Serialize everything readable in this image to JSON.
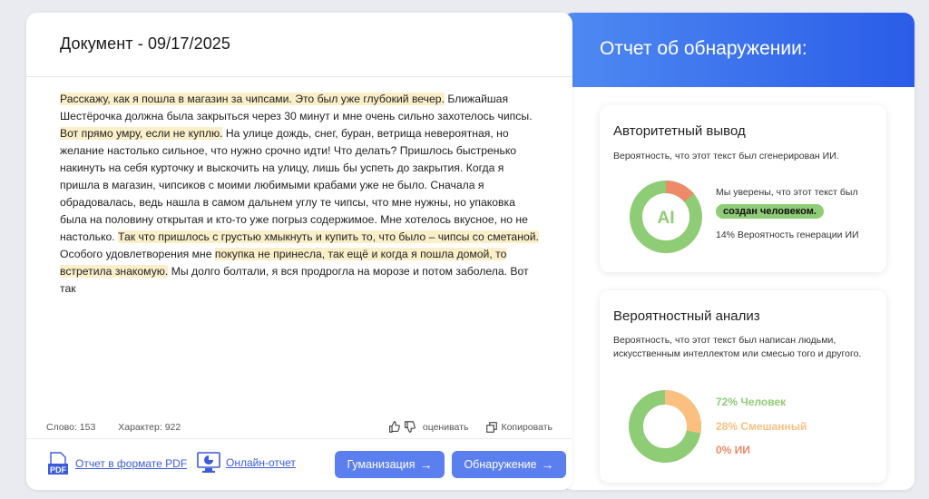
{
  "document": {
    "title": "Документ - 09/17/2025",
    "paragraph": [
      {
        "text": "Расскажу, как я пошла в магазин за чипсами. Это был уже глубокий вечер.",
        "hl": true
      },
      {
        "text": " Ближайшая Шестёрочка должна была закрыться через 30 минут и мне очень сильно захотелось чипсы. ",
        "hl": false
      },
      {
        "text": "Вот прямо умру, если не куплю.",
        "hl": true
      },
      {
        "text": " На улице дождь, снег, буран, ветрища невероятная, но желание настолько сильное, что нужно срочно идти! Что делать? Пришлось быстренько накинуть на себя курточку и выскочить на улицу, лишь бы успеть до закрытия. Когда я пришла в магазин, чипсиков с моими любимыми крабами уже не было. Сначала я обрадовалась, ведь нашла в самом дальнем углу те чипсы, что мне нужны, но упаковка была на половину открытая и кто-то уже погрыз содержимое. Мне хотелось вкусное, но не настолько. ",
        "hl": false
      },
      {
        "text": "Так что пришлось с грустью хмыкнуть и купить то, что было – чипсы со сметаной.",
        "hl": true
      },
      {
        "text": " Особого удовлетворения мне ",
        "hl": false
      },
      {
        "text": "покупка не принесла, так ещё и когда я пошла домой, то встретила знакомую.",
        "hl": true
      },
      {
        "text": " Мы долго болтали, я вся продрогла на морозе и потом заболела. Вот так",
        "hl": false
      }
    ],
    "stats": {
      "words": "Слово: 153",
      "chars": "Характер: 922"
    },
    "rate_label": "оценивать",
    "copy_label": "Копировать",
    "pdf_link": "Отчет в формате PDF",
    "online_link": "Онлайн-отчет",
    "humanize_label": "Гуманизация",
    "detect_label": "Обнаружение",
    "arrow": "→"
  },
  "report": {
    "title": "Отчет об обнаружении:",
    "authoritative": {
      "title": "Авторитетный вывод",
      "desc": "Вероятность, что этот текст был сгенерирован ИИ.",
      "center_label": "AI",
      "confident": "Мы уверены, что этот текст был",
      "verdict": "создан человеком.",
      "ai_prob": "14% Вероятность генерации ИИ",
      "ai_fraction": 0.14
    },
    "probabilistic": {
      "title": "Вероятностный анализ",
      "desc": "Вероятность, что этот текст был написан людьми, искусственным интеллектом или смесью того и другого.",
      "human": "72% Человек",
      "mixed": "28% Смешанный",
      "ai": "0% ИИ",
      "fractions": {
        "human": 0.72,
        "mixed": 0.28,
        "ai": 0.0
      }
    }
  },
  "colors": {
    "human": "#8fcc76",
    "mixed": "#fbbf7f",
    "ai": "#ec8a6a",
    "accent": "#5b7fee"
  }
}
